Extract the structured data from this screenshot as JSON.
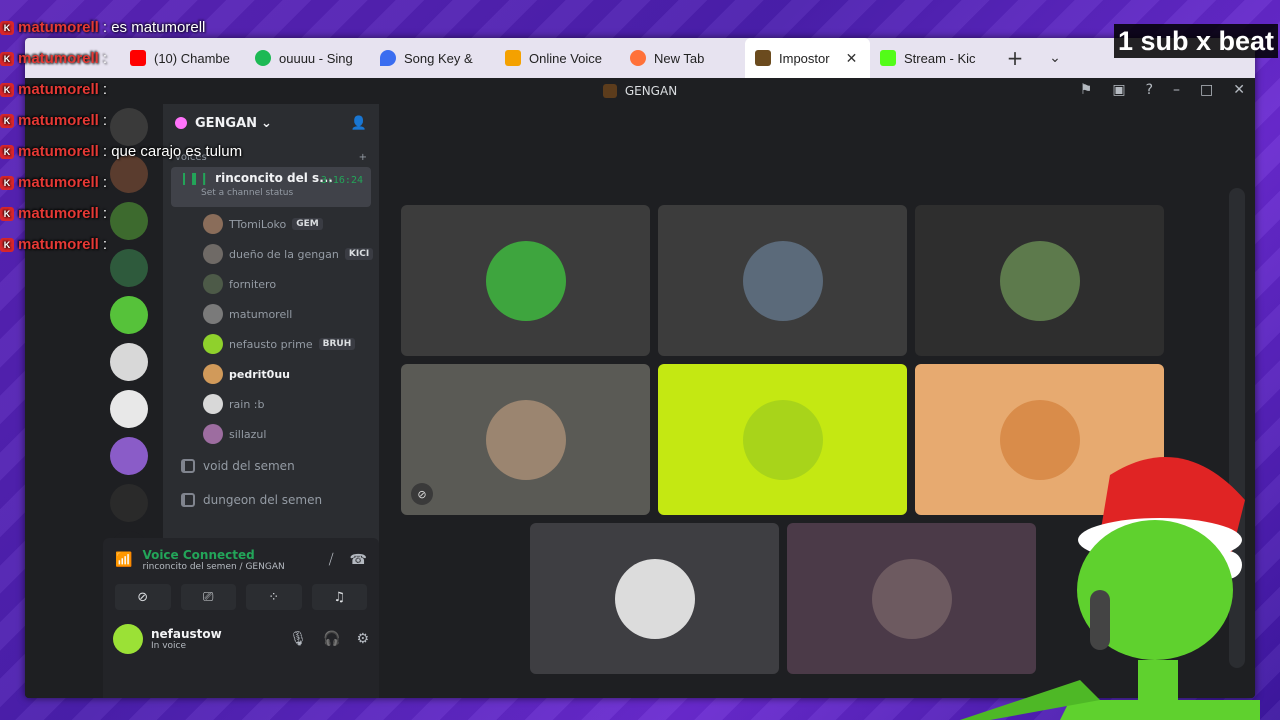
{
  "overlay": {
    "sub_text": "1 sub x beat"
  },
  "chat": {
    "lines": [
      {
        "user": "matumorell",
        "text": ": es matumorell"
      },
      {
        "user": "matumorell",
        "text": ":"
      },
      {
        "user": "matumorell",
        "text": ":"
      },
      {
        "user": "matumorell",
        "text": ":"
      },
      {
        "user": "matumorell",
        "text": ": que carajo es tulum"
      },
      {
        "user": "matumorell",
        "text": ":"
      },
      {
        "user": "matumorell",
        "text": ":"
      },
      {
        "user": "matumorell",
        "text": ":"
      }
    ]
  },
  "browser": {
    "tabs": [
      {
        "label": "(10) Chambe",
        "color": "#ff0000"
      },
      {
        "label": "ouuuu - Sing",
        "color": "#1db954"
      },
      {
        "label": "Song Key &",
        "color": "#3a6df0"
      },
      {
        "label": "Online Voice",
        "color": "#f4a100"
      },
      {
        "label": "New Tab",
        "color": "#ff7139"
      },
      {
        "label": "Impostor",
        "color": "#6b4b1e",
        "active": true
      },
      {
        "label": "Stream - Kic",
        "color": "#53fc18"
      }
    ]
  },
  "discord": {
    "window_title": "GENGAN",
    "server_name": "GENGAN",
    "category": "voices",
    "voice_channel": {
      "name": "rinconcito del s...",
      "time": "3:16:24",
      "status": "Set a channel status"
    },
    "members": [
      {
        "name": "TTomiLoko",
        "badge": "GEM",
        "color": "#8a6d5a"
      },
      {
        "name": "dueño de la gengan",
        "badge": "KICI",
        "color": "#6f6a66"
      },
      {
        "name": "fornitero",
        "color": "#4d5a48"
      },
      {
        "name": "matumorell",
        "color": "#7a7a7a"
      },
      {
        "name": "nefausto prime",
        "badge": "BRUH",
        "color": "#8fd12c"
      },
      {
        "name": "pedrit0uu",
        "color": "#d19a5a",
        "speaking": true
      },
      {
        "name": "rain :b",
        "color": "#d8d8d8"
      },
      {
        "name": "sillazul",
        "color": "#9d6da0"
      }
    ],
    "other_channels": [
      "void del semen",
      "dungeon del semen"
    ],
    "voice_panel": {
      "status": "Voice Connected",
      "location": "rinconcito del semen / GENGAN"
    },
    "user": {
      "name": "nefaustow",
      "status": "In voice"
    },
    "tiles": [
      {
        "bg": "#3c3c3c",
        "avatar": "#3ea53e"
      },
      {
        "bg": "#3c3c3c",
        "avatar": "#5b6a7a"
      },
      {
        "bg": "#2e2e2e",
        "avatar": "#5d7a4c"
      },
      {
        "bg": "#5a5a55",
        "avatar": "#9b8570"
      },
      {
        "bg": "#c4e812",
        "avatar": "#a8d41a"
      },
      {
        "bg": "#e7aa70",
        "avatar": "#d98c4a"
      },
      {
        "bg": "#3e3e42",
        "avatar": "#dcdcdc"
      },
      {
        "bg": "#4b3a48",
        "avatar": "#6d5a60"
      }
    ]
  }
}
